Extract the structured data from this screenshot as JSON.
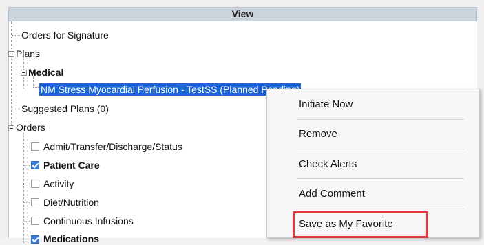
{
  "header": {
    "title": "View"
  },
  "tree": {
    "orders_for_signature": "Orders for Signature",
    "plans": "Plans",
    "medical": "Medical",
    "selected_plan": "NM Stress Myocardial Perfusion - TestSS (Planned Pending)",
    "suggested_plans": "Suggested Plans (0)",
    "orders": "Orders",
    "categories": [
      {
        "label": "Admit/Transfer/Discharge/Status",
        "checked": false,
        "bold": false
      },
      {
        "label": "Patient Care",
        "checked": true,
        "bold": true
      },
      {
        "label": "Activity",
        "checked": false,
        "bold": false
      },
      {
        "label": "Diet/Nutrition",
        "checked": false,
        "bold": false
      },
      {
        "label": "Continuous Infusions",
        "checked": false,
        "bold": false
      },
      {
        "label": "Medications",
        "checked": true,
        "bold": true
      }
    ]
  },
  "context_menu": {
    "items": [
      "Initiate Now",
      "Remove",
      "Check Alerts",
      "Add Comment",
      "Save as My Favorite"
    ]
  },
  "colors": {
    "selection": "#1b66d4",
    "highlight_box": "#e0393a",
    "header_bg": "#cbd3dc"
  }
}
